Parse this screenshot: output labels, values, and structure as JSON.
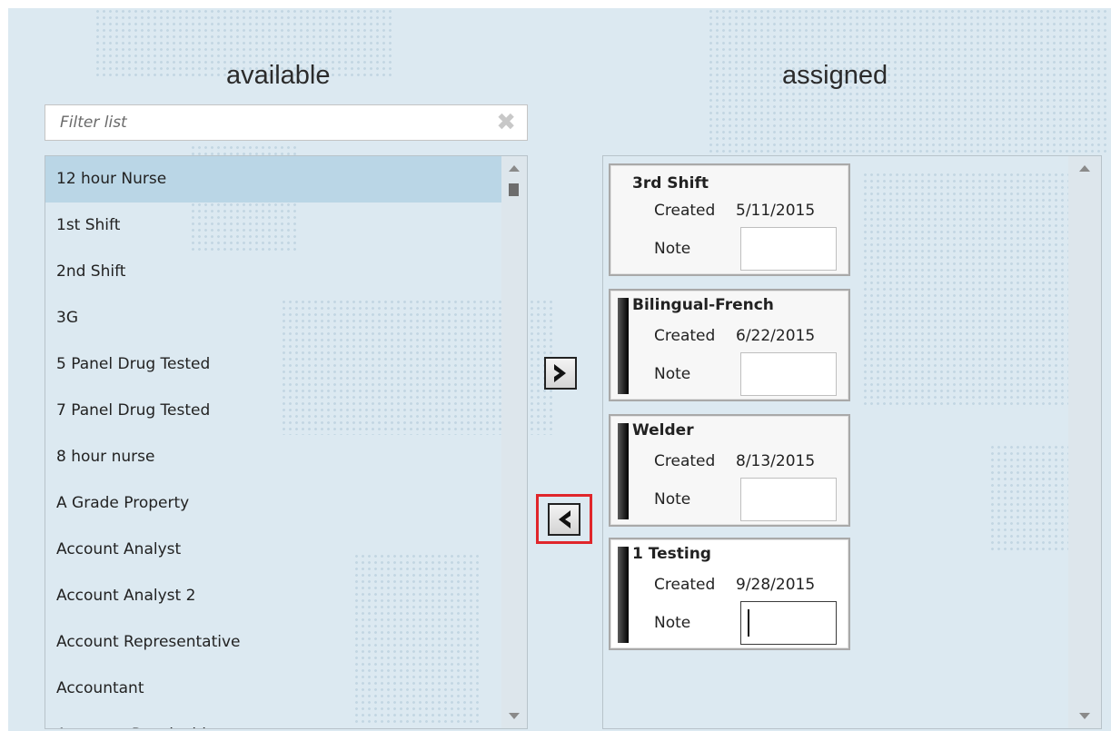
{
  "available": {
    "heading": "available",
    "filter_placeholder": "Filter list",
    "items": [
      "12 hour Nurse",
      "1st Shift",
      "2nd Shift",
      "3G",
      "5 Panel Drug Tested",
      "7 Panel Drug Tested",
      "8 hour nurse",
      "A Grade Property",
      "Account Analyst",
      "Account Analyst 2",
      "Account Representative",
      "Accountant",
      "Accounts Receivable"
    ],
    "selected_index": 0
  },
  "assigned": {
    "heading": "assigned",
    "created_label": "Created",
    "note_label": "Note",
    "cards": [
      {
        "title": "3rd Shift",
        "created": "5/11/2015",
        "note": ""
      },
      {
        "title": "Bilingual-French",
        "created": "6/22/2015",
        "note": ""
      },
      {
        "title": "Welder",
        "created": "8/13/2015",
        "note": ""
      },
      {
        "title": "1 Testing",
        "created": "9/28/2015",
        "note": ""
      }
    ]
  },
  "buttons": {
    "add_icon": "chevron-right-icon",
    "remove_icon": "chevron-left-icon"
  },
  "colors": {
    "background": "#dce9f1",
    "selected_row": "#bad6e6",
    "highlight_border": "#e0262b"
  }
}
